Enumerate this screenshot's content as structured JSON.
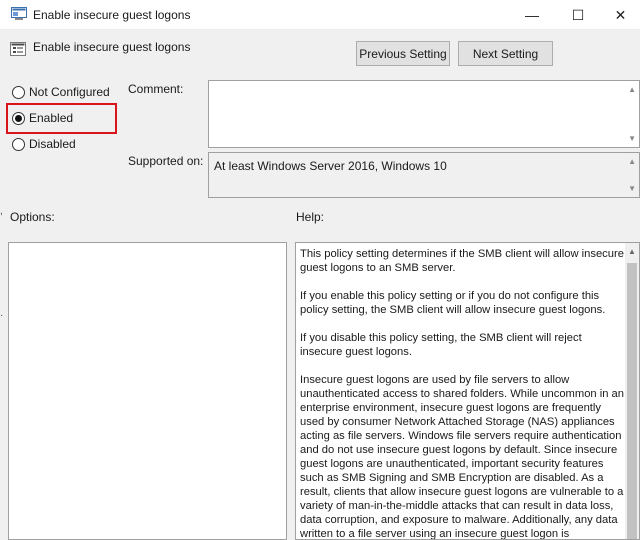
{
  "window": {
    "title": "Enable insecure guest logons",
    "controls": {
      "minimize": "—",
      "maximize": "☐",
      "close": "✕"
    }
  },
  "header": {
    "policy_name": "Enable insecure guest logons",
    "previous_label": "Previous Setting",
    "next_label": "Next Setting"
  },
  "state": {
    "options": [
      {
        "label": "Not Configured",
        "selected": false
      },
      {
        "label": "Enabled",
        "selected": true
      },
      {
        "label": "Disabled",
        "selected": false
      }
    ],
    "highlight_color": "#d9141a"
  },
  "fields": {
    "comment_label": "Comment:",
    "comment_value": "",
    "supported_label": "Supported on:",
    "supported_value": "At least Windows Server 2016, Windows 10"
  },
  "panels": {
    "options_label": "Options:",
    "help_label": "Help:",
    "help_paragraphs": [
      "This policy setting determines if the SMB client will allow insecure guest logons to an SMB server.",
      "If you enable this policy setting or if you do not configure this policy setting, the SMB client will allow insecure guest logons.",
      "If you disable this policy setting, the SMB client will reject insecure guest logons.",
      "Insecure guest logons are used by file servers to allow unauthenticated access to shared folders. While uncommon in an enterprise environment, insecure guest logons are frequently used by consumer Network Attached Storage (NAS) appliances acting as file servers. Windows file servers require authentication and do not use insecure guest logons by default. Since insecure guest logons are unauthenticated, important security features such as SMB Signing and SMB Encryption are disabled. As a result, clients that allow insecure guest logons are vulnerable to a variety of man-in-the-middle attacks that can result in data loss, data corruption, and exposure to malware. Additionally, any data written to a file server using an insecure guest logon is"
    ]
  }
}
